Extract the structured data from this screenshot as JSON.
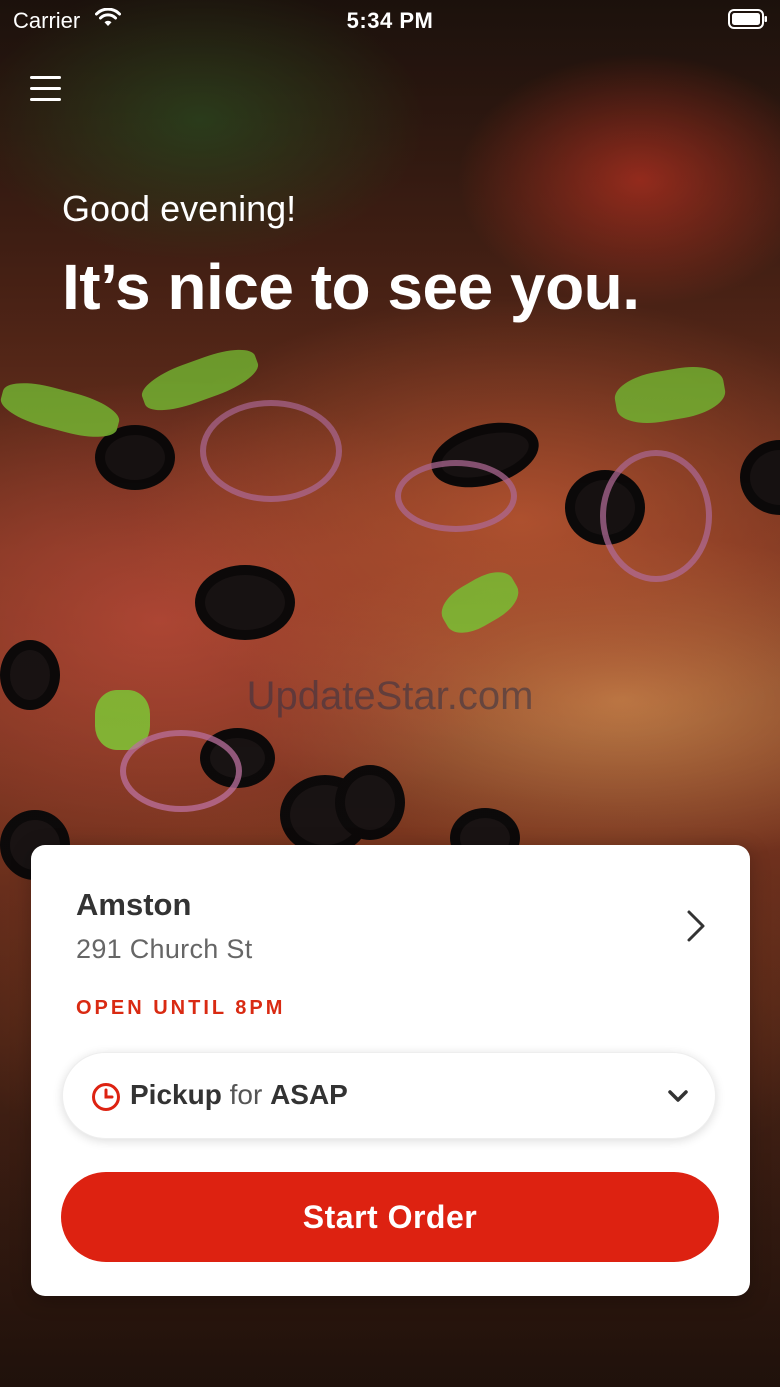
{
  "status_bar": {
    "carrier": "Carrier",
    "time": "5:34 PM"
  },
  "hero": {
    "greeting": "Good evening!",
    "headline": "It’s nice to see you."
  },
  "watermark": "UpdateStar.com",
  "store": {
    "name": "Amston",
    "address": "291 Church St",
    "hours_status": "OPEN UNTIL 8PM"
  },
  "order_mode": {
    "mode": "Pickup",
    "connector": "for",
    "when": "ASAP"
  },
  "actions": {
    "start_order_label": "Start Order"
  },
  "colors": {
    "accent": "#dd2211",
    "card_background": "#ffffff"
  },
  "icons": [
    "wifi-icon",
    "battery-icon",
    "menu-icon",
    "chevron-right-icon",
    "clock-icon",
    "chevron-down-icon"
  ]
}
